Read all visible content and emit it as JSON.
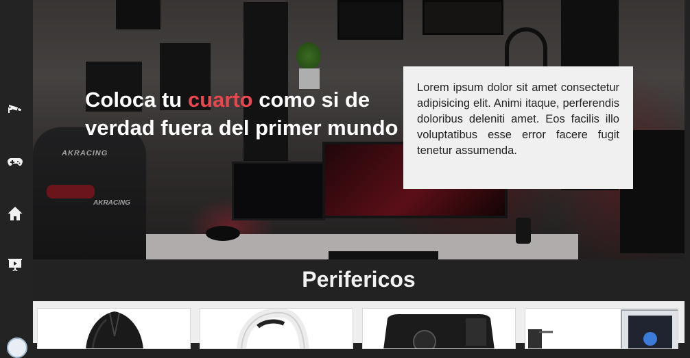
{
  "sidebar": {
    "items": [
      {
        "name": "security-camera-icon"
      },
      {
        "name": "gamepad-icon"
      },
      {
        "name": "home-icon"
      },
      {
        "name": "presentation-icon"
      }
    ]
  },
  "hero": {
    "headline_part1": "Coloca tu ",
    "headline_accent": "cuarto",
    "headline_part2": " como si de verdad fuera del primer mundo",
    "chair_brand": "AKRACING",
    "body_text": "Lorem ipsum dolor sit amet consectetur adipisicing elit. Animi itaque, perferendis doloribus deleniti amet. Eos facilis illo voluptatibus esse error facere fugit tenetur assumenda."
  },
  "section": {
    "title": "Perifericos"
  },
  "products": [
    {
      "name": "gaming-mouse"
    },
    {
      "name": "headset"
    },
    {
      "name": "webcam"
    },
    {
      "name": "desktop-pc"
    }
  ],
  "colors": {
    "accent": "#e8474f",
    "background": "#222222",
    "text_box": "#f0f0f0"
  }
}
